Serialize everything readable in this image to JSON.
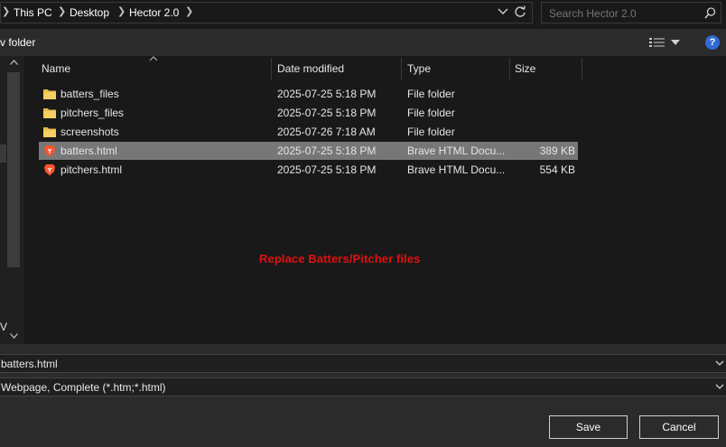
{
  "breadcrumb": {
    "items": [
      "This PC",
      "Desktop",
      "Hector 2.0"
    ]
  },
  "search": {
    "placeholder": "Search Hector 2.0"
  },
  "toolbar": {
    "new_folder_label": "v folder",
    "help_label": "?"
  },
  "nav": {
    "partial_label": "V"
  },
  "columns": {
    "name": "Name",
    "date": "Date modified",
    "type": "Type",
    "size": "Size"
  },
  "files": [
    {
      "name": "batters_files",
      "date": "2025-07-25 5:18 PM",
      "type": "File folder",
      "size": "",
      "icon": "folder-icon"
    },
    {
      "name": "pitchers_files",
      "date": "2025-07-25 5:18 PM",
      "type": "File folder",
      "size": "",
      "icon": "folder-icon"
    },
    {
      "name": "screenshots",
      "date": "2025-07-26 7:18 AM",
      "type": "File folder",
      "size": "",
      "icon": "folder-icon"
    },
    {
      "name": "batters.html",
      "date": "2025-07-25 5:18 PM",
      "type": "Brave HTML Docu...",
      "size": "389 KB",
      "icon": "brave-icon",
      "selected": true
    },
    {
      "name": "pitchers.html",
      "date": "2025-07-25 5:18 PM",
      "type": "Brave HTML Docu...",
      "size": "554 KB",
      "icon": "brave-icon"
    }
  ],
  "annotation": "Replace Batters/Pitcher files",
  "filename": {
    "value": "batters.html"
  },
  "save_type": {
    "value": "Webpage, Complete (*.htm;*.html)"
  },
  "buttons": {
    "save": "Save",
    "cancel": "Cancel"
  },
  "colors": {
    "selection": "#777777",
    "annotation": "#e01010",
    "help": "#2f6bd6"
  }
}
